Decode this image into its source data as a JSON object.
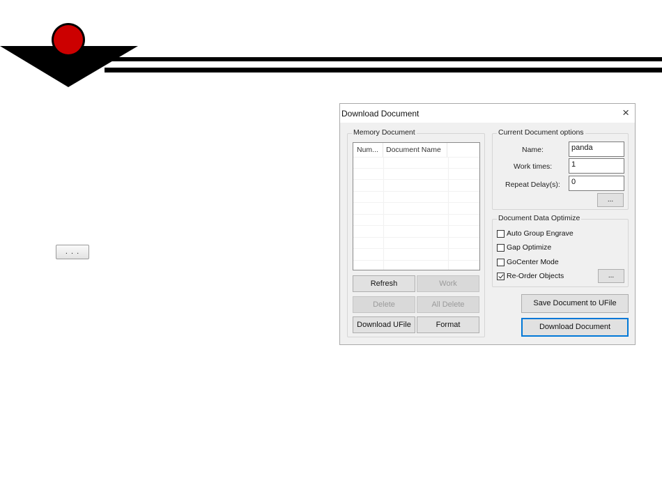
{
  "slide": {
    "small_button_label": ". . ."
  },
  "dialog": {
    "title": "Download Document",
    "close_glyph": "×",
    "memory": {
      "group_title": "Memory Document",
      "columns": [
        "Num...",
        "Document Name"
      ],
      "buttons": {
        "refresh": "Refresh",
        "work": "Work",
        "delete": "Delete",
        "all_delete": "All Delete",
        "download_ufile": "Download UFile",
        "format": "Format"
      }
    },
    "options": {
      "group_title": "Current Document options",
      "name_label": "Name:",
      "name_value": "panda",
      "work_times_label": "Work times:",
      "work_times_value": "1",
      "repeat_delay_label": "Repeat Delay(s):",
      "repeat_delay_value": "0",
      "more_button": "..."
    },
    "optimize": {
      "group_title": "Document Data Optimize",
      "auto_group": {
        "label": "Auto Group Engrave",
        "checked": false
      },
      "gap_optimize": {
        "label": "Gap Optimize",
        "checked": false
      },
      "gocenter": {
        "label": "GoCenter Mode",
        "checked": false
      },
      "reorder": {
        "label": "Re-Order Objects",
        "checked": true
      },
      "more_button": "..."
    },
    "save_button": "Save Document to UFile",
    "download_button": "Download Document"
  },
  "colors": {
    "logo_red": "#cc0000",
    "logo_black": "#000000",
    "accent_blue": "#0078d7"
  }
}
